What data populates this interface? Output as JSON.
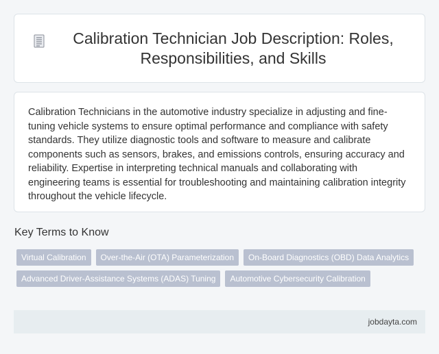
{
  "header": {
    "title": "Calibration Technician Job Description: Roles, Responsibilities, and Skills",
    "icon": "document-icon"
  },
  "description": {
    "text": "Calibration Technicians in the automotive industry specialize in adjusting and fine-tuning vehicle systems to ensure optimal performance and compliance with safety standards. They utilize diagnostic tools and software to measure and calibrate components such as sensors, brakes, and emissions controls, ensuring accuracy and reliability. Expertise in interpreting technical manuals and collaborating with engineering teams is essential for troubleshooting and maintaining calibration integrity throughout the vehicle lifecycle."
  },
  "key_terms": {
    "heading": "Key Terms to Know",
    "items": [
      "Virtual Calibration",
      "Over-the-Air (OTA) Parameterization",
      "On-Board Diagnostics (OBD) Data Analytics",
      "Advanced Driver-Assistance Systems (ADAS) Tuning",
      "Automotive Cybersecurity Calibration"
    ]
  },
  "footer": {
    "site": "jobdayta.com"
  },
  "colors": {
    "background": "#f4f6f8",
    "card": "#ffffff",
    "tag": "#b9c0d0",
    "footer": "#e7edf0"
  }
}
